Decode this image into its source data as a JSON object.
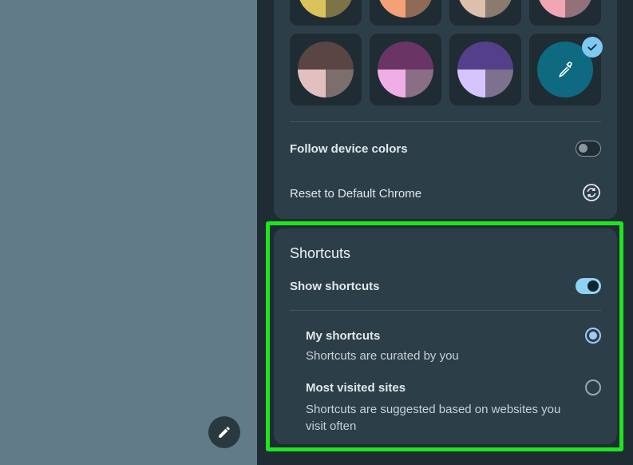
{
  "colors": {
    "accent_highlight": "#1ee61e",
    "panel_bg": "#1f2c33",
    "card_bg": "#2c3e48",
    "page_bg": "#617b89"
  },
  "theme_swatches": {
    "partial_row": [
      {
        "name": "yellow-olive",
        "top": "#d9c35d",
        "bl": "#d9c35d",
        "br": "#7c7446"
      },
      {
        "name": "peach-brown",
        "top": "#f3a176",
        "bl": "#f3a176",
        "br": "#8f6b57"
      },
      {
        "name": "beige-taupe",
        "top": "#ddbfae",
        "bl": "#ddbfae",
        "br": "#8a7a70"
      },
      {
        "name": "pink-mauve",
        "top": "#f2a6b5",
        "bl": "#f2a6b5",
        "br": "#94707a"
      }
    ],
    "row": [
      {
        "name": "brown-rose",
        "top": "#5a4444",
        "bl": "#e2c0c0",
        "br": "#7d6e6e"
      },
      {
        "name": "plum-pink",
        "top": "#6a3564",
        "bl": "#f0aee6",
        "br": "#8a6e86"
      },
      {
        "name": "indigo-lavender",
        "top": "#54408a",
        "bl": "#d6c4ff",
        "br": "#7d7190"
      }
    ],
    "custom": {
      "icon": "eyedropper-icon",
      "color": "#0d6a80",
      "selected": true
    }
  },
  "appearance": {
    "follow_device_label": "Follow device colors",
    "follow_device_on": false,
    "reset_label": "Reset to Default Chrome",
    "reset_icon": "reset-icon"
  },
  "shortcuts": {
    "title": "Shortcuts",
    "show_label": "Show shortcuts",
    "show_on": true,
    "options": [
      {
        "title": "My shortcuts",
        "desc": "Shortcuts are curated by you",
        "checked": true
      },
      {
        "title": "Most visited sites",
        "desc": "Shortcuts are suggested based on websites you visit often",
        "checked": false
      }
    ]
  },
  "fab": {
    "icon": "pencil-icon"
  }
}
